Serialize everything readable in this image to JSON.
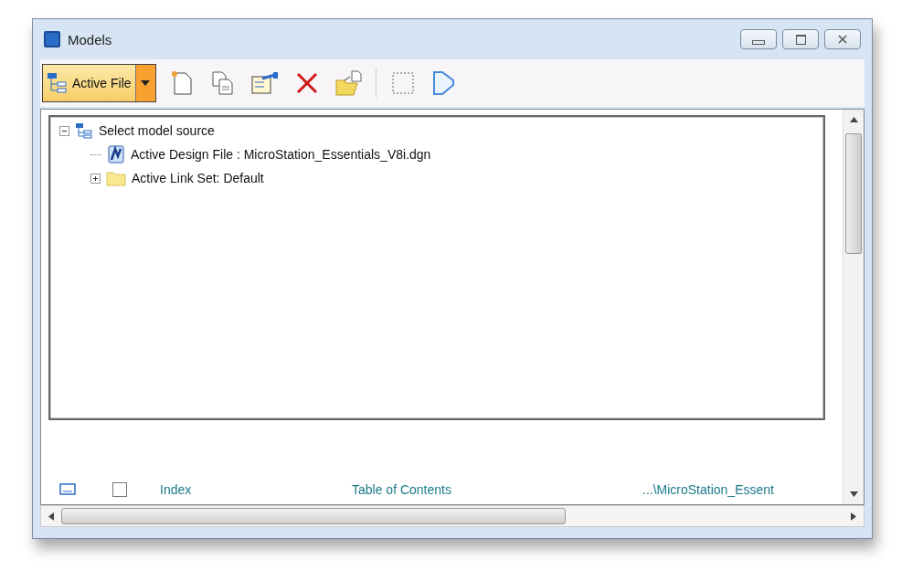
{
  "window": {
    "title": "Models"
  },
  "toolbar": {
    "source_button": {
      "label": "Active File"
    }
  },
  "source_tree": {
    "items": [
      {
        "label": "Select model source",
        "expanded": true,
        "children": [
          {
            "label": "Active Design File : MicroStation_Essentials_V8i.dgn",
            "kind": "file"
          },
          {
            "label": "Active Link Set: Default",
            "kind": "folder",
            "expanded": false
          }
        ]
      }
    ]
  },
  "models": {
    "rows": [
      {
        "name": "Index",
        "description": "Table of Contents",
        "file": "...\\MicroStation_Essent",
        "checked": false
      }
    ]
  }
}
